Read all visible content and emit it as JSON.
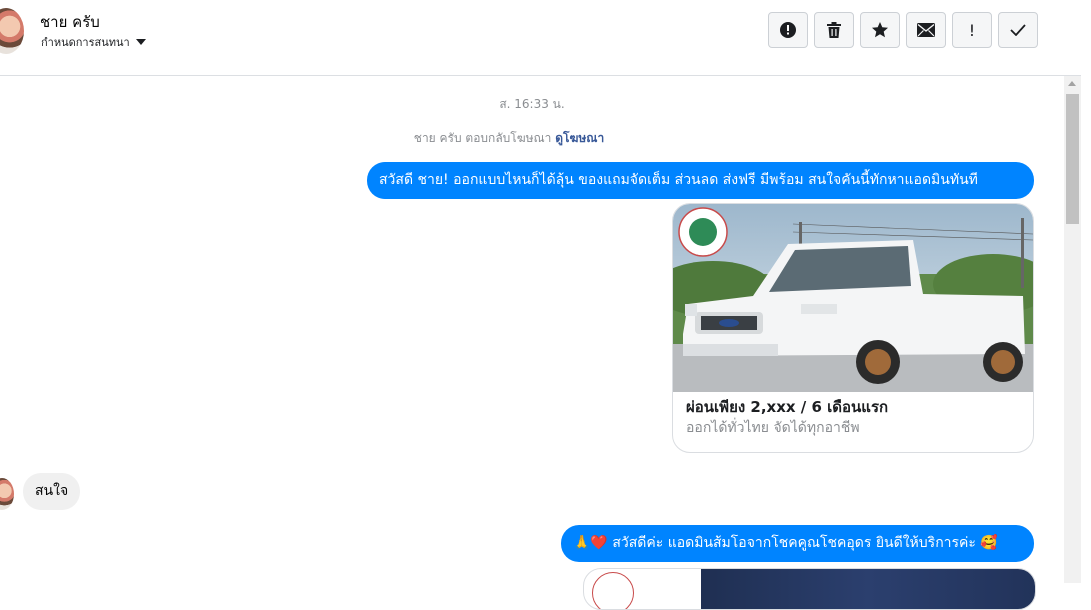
{
  "header": {
    "contact_name": "ชาย ครับ",
    "conversation_action": "กำหนดการสนทนา",
    "toolbar": [
      {
        "name": "report-spam-button",
        "icon": "alert-circle-icon"
      },
      {
        "name": "delete-button",
        "icon": "trash-icon"
      },
      {
        "name": "star-button",
        "icon": "star-icon"
      },
      {
        "name": "mark-unread-button",
        "icon": "envelope-icon"
      },
      {
        "name": "flag-button",
        "icon": "exclamation-icon",
        "glyph": "!"
      },
      {
        "name": "mark-done-button",
        "icon": "checkmark-icon"
      }
    ]
  },
  "conversation": {
    "timestamp": "ส. 16:33 น.",
    "reply_note": "ชาย ครับ ตอบกลับโฆษณา",
    "reply_link": "ดูโฆษณา",
    "messages": [
      {
        "direction": "outgoing",
        "text": "สวัสดี ชาย! ออกแบบไหนก็ได้ลุ้น ของแถมจัดเต็ม ส่วนลด ส่งฟรี มีพร้อม สนใจคันนี้ทักหาแอดมินทันที"
      },
      {
        "direction": "outgoing",
        "type": "card",
        "title": "ผ่อนเพียง 2,xxx / 6 เดือนแรก",
        "subtitle": "ออกได้ทั่วไทย จัดได้ทุกอาชีพ"
      },
      {
        "direction": "incoming",
        "text": "สนใจ"
      },
      {
        "direction": "outgoing",
        "text": "🙏❤️ สวัสดีค่ะ แอดมินส้มโอจากโชคคูณโชคอุดร ยินดีให้บริการค่ะ 🥰"
      }
    ]
  },
  "colors": {
    "outgoing_bubble": "#0084ff",
    "incoming_bubble": "#f0f0f0",
    "link": "#385898",
    "meta_text": "#8a8d91"
  }
}
